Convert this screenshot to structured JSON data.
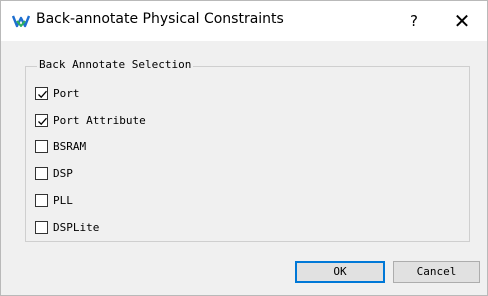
{
  "window": {
    "title": "Back-annotate Physical Constraints",
    "help_label": "?",
    "close_label": "✕"
  },
  "group": {
    "title": "Back Annotate Selection",
    "items": [
      {
        "label": "Port",
        "checked": true
      },
      {
        "label": "Port Attribute",
        "checked": true
      },
      {
        "label": "BSRAM",
        "checked": false
      },
      {
        "label": "DSP",
        "checked": false
      },
      {
        "label": "PLL",
        "checked": false
      },
      {
        "label": "DSPLite",
        "checked": false
      }
    ]
  },
  "buttons": {
    "ok_label": "OK",
    "cancel_label": "Cancel"
  },
  "colors": {
    "accent": "#0078d7",
    "icon_blue": "#1e6fd0",
    "icon_green": "#2fb15a"
  }
}
